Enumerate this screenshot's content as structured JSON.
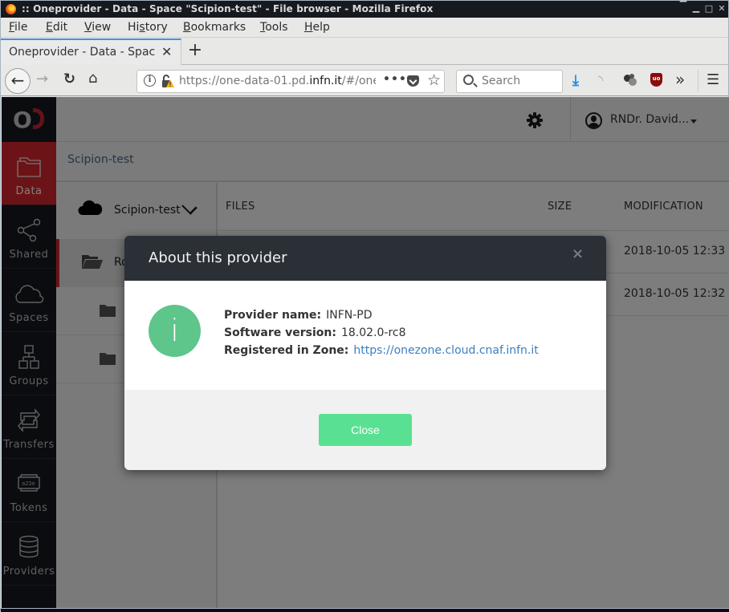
{
  "window": {
    "title": ":: Oneprovider - Data - Space \"Scipion-test\" - File browser - Mozilla Firefox",
    "controls": [
      "minimize-all",
      "minimize",
      "maximize",
      "close"
    ]
  },
  "menubar": {
    "items": [
      {
        "label": "File",
        "accesskey": "F"
      },
      {
        "label": "Edit",
        "accesskey": "E"
      },
      {
        "label": "View",
        "accesskey": "V"
      },
      {
        "label": "History",
        "accesskey": "s"
      },
      {
        "label": "Bookmarks",
        "accesskey": "B"
      },
      {
        "label": "Tools",
        "accesskey": "T"
      },
      {
        "label": "Help",
        "accesskey": "H"
      }
    ]
  },
  "tabs": [
    {
      "title": "Oneprovider - Data - Space \"Scipion-test\"",
      "active": true
    }
  ],
  "navbar": {
    "url_prefix": "https://one-data-01.pd.",
    "url_domain": "infn.it",
    "url_suffix": "/#/onedata/data/Scipion-test",
    "search_placeholder": "Search",
    "overflow_glyph": "•••"
  },
  "sidebar": {
    "logo_text": "O",
    "items": [
      {
        "label": "Data",
        "icon": "folder-icon",
        "active": true
      },
      {
        "label": "Shared",
        "icon": "share-icon",
        "active": false
      },
      {
        "label": "Spaces",
        "icon": "cloud-icon",
        "active": false
      },
      {
        "label": "Groups",
        "icon": "groups-icon",
        "active": false
      },
      {
        "label": "Transfers",
        "icon": "transfers-icon",
        "active": false
      },
      {
        "label": "Tokens",
        "icon": "token-icon",
        "active": false
      },
      {
        "label": "Providers",
        "icon": "database-icon",
        "active": false
      }
    ],
    "token_icon_text": "a23e"
  },
  "topbar": {
    "user_name": "RNDr. David..."
  },
  "breadcrumb": {
    "current": "Scipion-test"
  },
  "tree": {
    "space_name": "Scipion-test",
    "root_label": "Root"
  },
  "files": {
    "columns": {
      "name": "FILES",
      "size": "SIZE",
      "modification": "MODIFICATION"
    },
    "rows": [
      {
        "modification": "2018-10-05 12:33"
      },
      {
        "modification": "2018-10-05 12:32"
      }
    ]
  },
  "modal": {
    "title": "About this provider",
    "close_glyph": "×",
    "badge_glyph": "i",
    "fields": [
      {
        "label": "Provider name:",
        "value": "INFN-PD"
      },
      {
        "label": "Software version:",
        "value": "18.02.0-rc8"
      },
      {
        "label": "Registered in Zone:",
        "value": "https://onezone.cloud.cnaf.infn.it"
      }
    ],
    "close_button": "Close"
  },
  "colors": {
    "accent_red": "#d9262e",
    "modal_header": "#2b3037",
    "info_green": "#5ec58b",
    "button_green": "#5ae092",
    "link_blue": "#3a7fc0"
  }
}
